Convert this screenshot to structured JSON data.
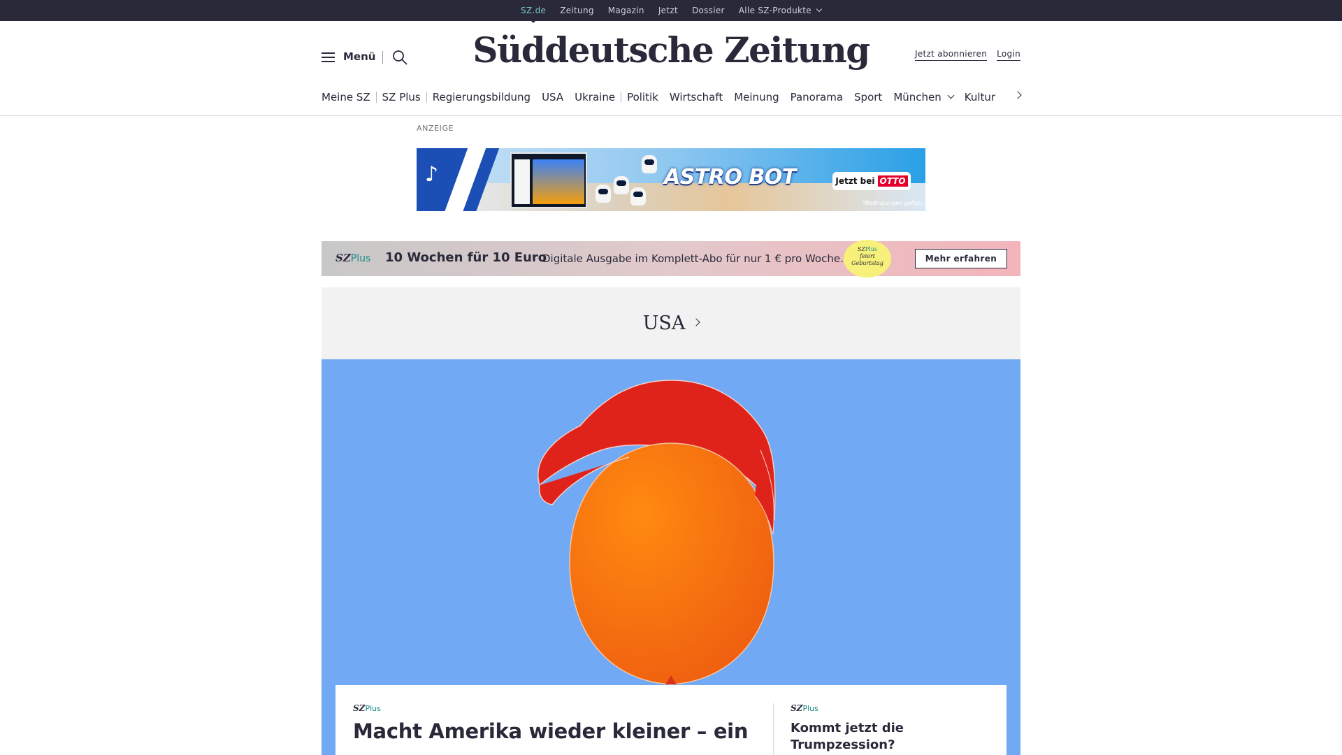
{
  "topbar": {
    "items": [
      {
        "label": "SZ.de",
        "active": true
      },
      {
        "label": "Zeitung"
      },
      {
        "label": "Magazin"
      },
      {
        "label": "Jetzt"
      },
      {
        "label": "Dossier"
      },
      {
        "label": "Alle SZ-Produkte"
      }
    ]
  },
  "header": {
    "menu_label": "Menü",
    "logo": "Süddeutsche Zeitung",
    "subscribe_label": "Jetzt abonnieren",
    "login_label": "Login"
  },
  "nav": {
    "items": [
      "Meine SZ",
      "SZ Plus",
      "Regierungsbildung",
      "USA",
      "Ukraine",
      "Politik",
      "Wirtschaft",
      "Meinung",
      "Panorama",
      "Sport",
      "München",
      "Kultur"
    ]
  },
  "ad": {
    "label": "ANZEIGE",
    "title": "ASTRO BOT",
    "cta_prefix": "Jetzt bei",
    "cta_brand": "OTTO",
    "fine_print": "*Bedingungen gelten."
  },
  "promo": {
    "logo_sz": "SZ",
    "logo_plus": "Plus",
    "headline": "10 Wochen für 10 Euro",
    "text": "Digitale Ausgabe im Komplett-Abo für nur 1 € pro Woche.",
    "badge_line1": "feiert",
    "badge_line2": "Geburtstag",
    "button": "Mehr erfahren"
  },
  "section": {
    "title": "USA"
  },
  "teaser": {
    "main": {
      "badge_sz": "SZ",
      "badge_plus": "Plus",
      "headline": "Macht Amerika wieder kleiner – ein"
    },
    "side": {
      "badge_sz": "SZ",
      "badge_plus": "Plus",
      "headline": "Kommt jetzt die Trumpzession?"
    }
  },
  "colors": {
    "topbar_bg": "#29293a",
    "accent_teal": "#1d8a87",
    "hero_bg": "#71a9f5",
    "cap_red": "#e0231a",
    "balloon_orange": "#f4770c"
  }
}
